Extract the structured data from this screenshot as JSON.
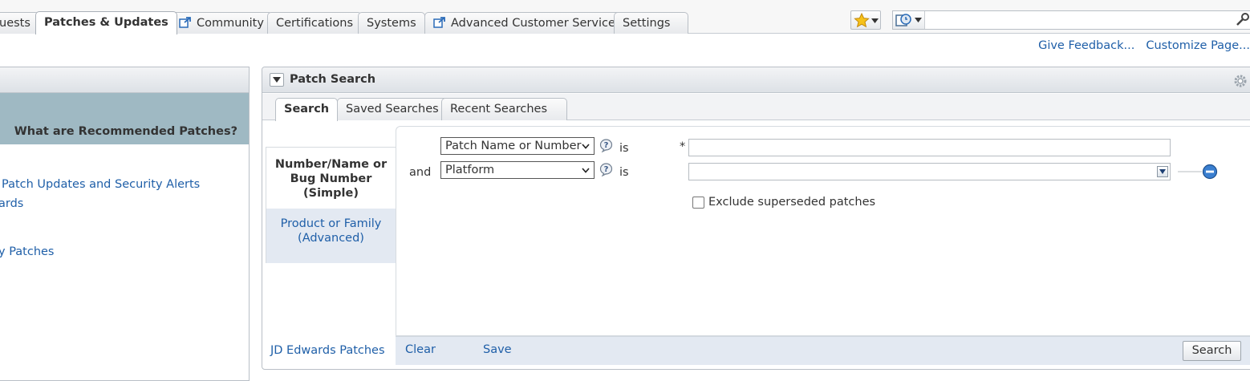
{
  "top_tabs": [
    {
      "label": "uests",
      "external": false,
      "active": false
    },
    {
      "label": "Patches & Updates",
      "external": false,
      "active": true
    },
    {
      "label": "Community",
      "external": true,
      "active": false
    },
    {
      "label": "Certifications",
      "external": false,
      "active": false
    },
    {
      "label": "Systems",
      "external": false,
      "active": false
    },
    {
      "label": "Advanced Customer Services",
      "external": true,
      "active": false
    },
    {
      "label": "Settings",
      "external": false,
      "active": false
    }
  ],
  "util_links": {
    "feedback": "Give Feedback...",
    "customize": "Customize Page..."
  },
  "left_panel": {
    "heading": "What are Recommended Patches?",
    "links": [
      "Patch Updates and Security Alerts",
      "ards",
      "y Patches"
    ]
  },
  "patch_search": {
    "title": "Patch Search",
    "tabs": [
      "Search",
      "Saved Searches",
      "Recent Searches"
    ],
    "mode_simple": {
      "line1": "Number/Name or",
      "line2": "Bug Number",
      "line3": "(Simple)"
    },
    "mode_advanced": {
      "line1": "Product or Family",
      "line2": "(Advanced)"
    },
    "jde_link": "JD Edwards Patches",
    "row1": {
      "field": "Patch Name or Number",
      "operator": "is",
      "required_mark": "*",
      "value": ""
    },
    "row2": {
      "conjunction": "and",
      "field": "Platform",
      "operator": "is",
      "value": ""
    },
    "exclude_label": "Exclude superseded patches",
    "exclude_checked": false,
    "footer": {
      "clear": "Clear",
      "save": "Save",
      "search": "Search"
    }
  },
  "colors": {
    "link": "#1f5fa8",
    "band": "#9fb9c3",
    "mode_selected_bg": "#e3e9f2"
  }
}
